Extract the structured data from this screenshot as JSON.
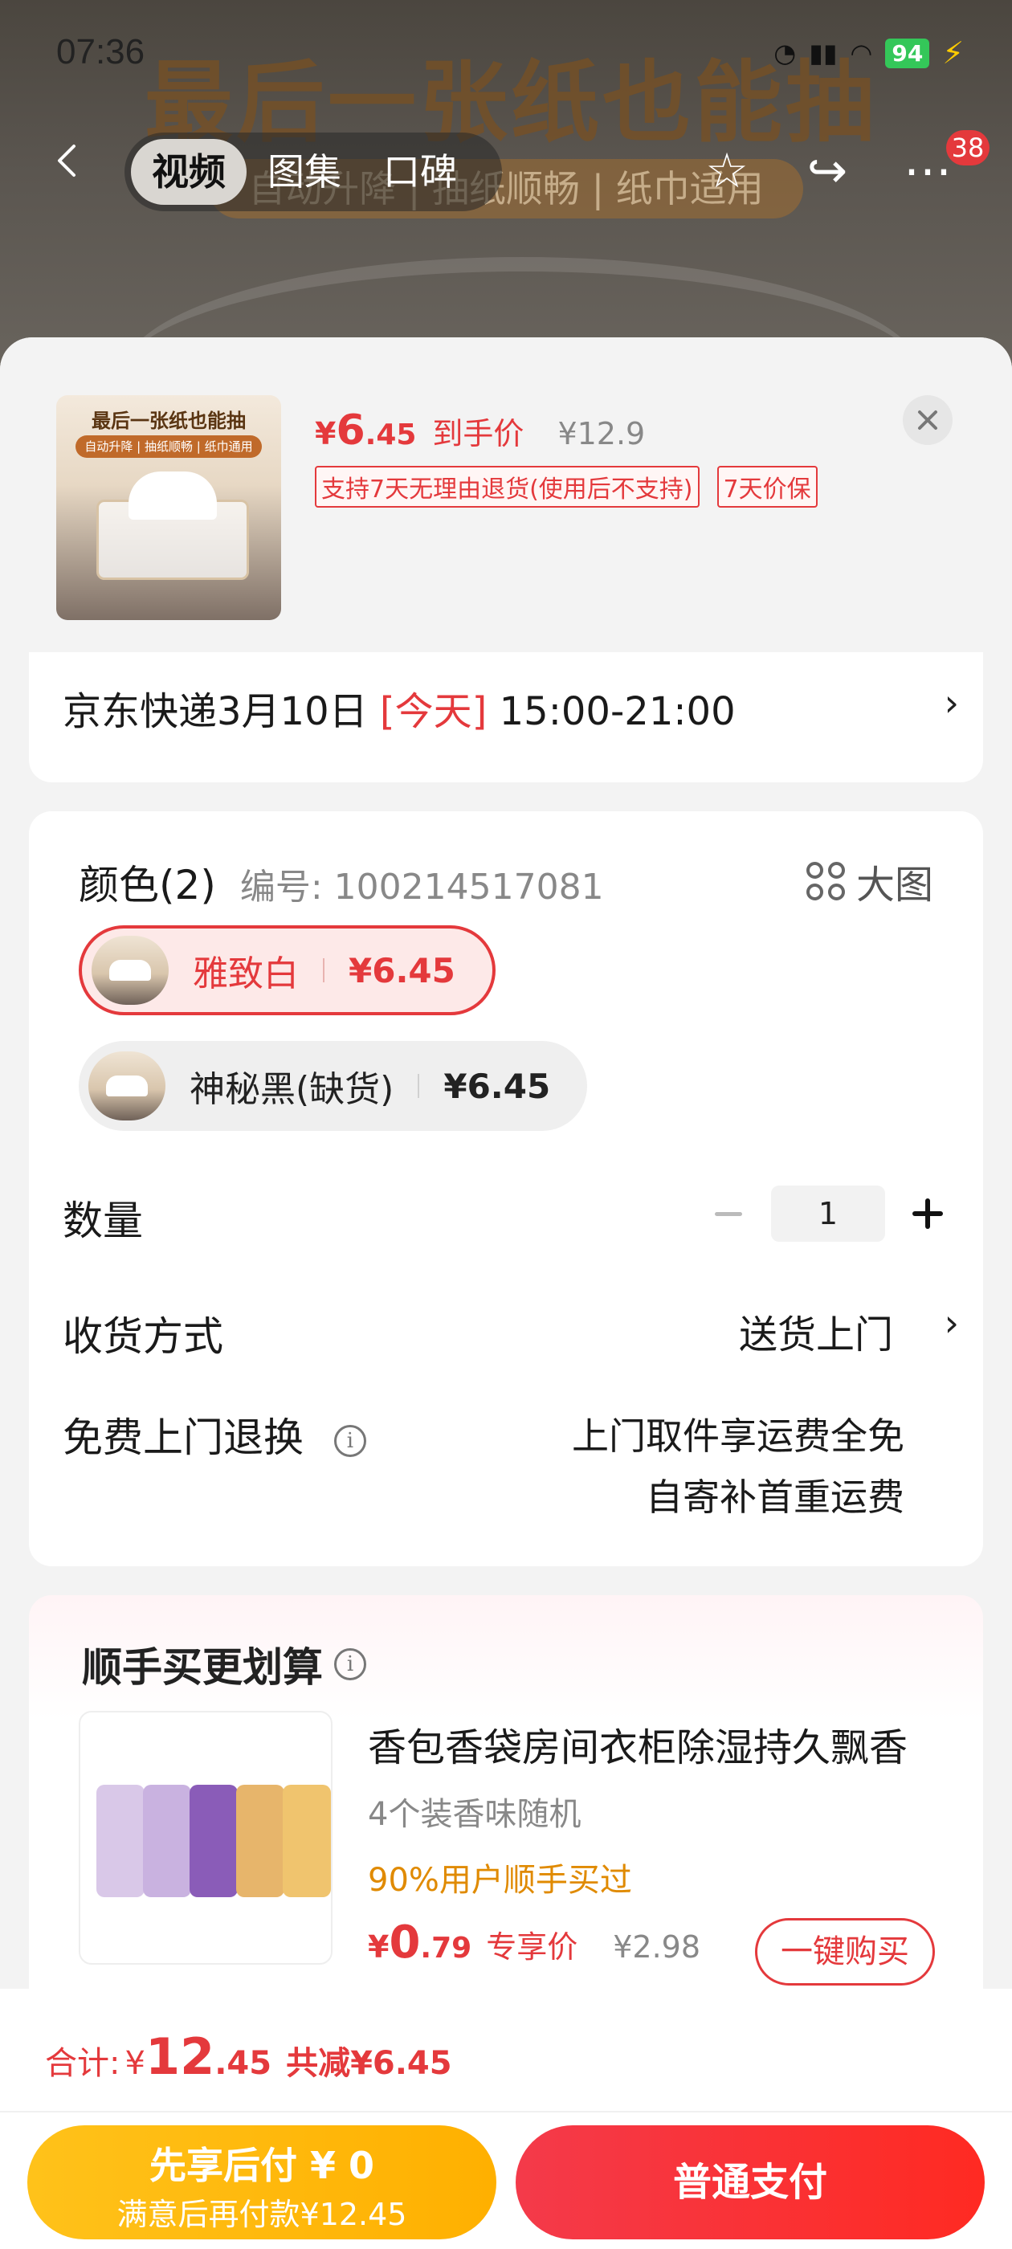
{
  "status_bar": {
    "time": "07:36",
    "battery": "94"
  },
  "hero": {
    "title": "最后一张纸也能抽",
    "subtitle": "自动升降 | 抽纸顺畅 | 纸巾适用"
  },
  "media_tabs": [
    "视频",
    "图集",
    "口碑"
  ],
  "cart_badge": "38",
  "product": {
    "thumb_title": "最后一张纸也能抽",
    "thumb_tag": "自动升降 | 抽纸顺畅 | 纸巾通用",
    "price_yen": "¥",
    "price_int": "6",
    "price_dec": ".45",
    "price_label": "到手价",
    "original_price": "¥12.9",
    "tags": [
      "支持7天无理由退货(使用后不支持)",
      "7天价保"
    ]
  },
  "shipping": {
    "prefix": "京东快递3月10日",
    "today": "[今天]",
    "window": "15:00-21:00"
  },
  "spec": {
    "title": "颜色(2)",
    "code": "编号: 100214517081",
    "big_view": "大图",
    "variants": [
      {
        "name": "雅致白",
        "suffix": "",
        "price": "¥6.45",
        "selected": true
      },
      {
        "name": "神秘黑",
        "suffix": "(缺货)",
        "price": "¥6.45",
        "selected": false
      }
    ],
    "quantity_label": "数量",
    "quantity": "1",
    "delivery_label": "收货方式",
    "delivery_value": "送货上门",
    "return_label": "免费上门退换",
    "return_lines": [
      "上门取件享运费全免",
      "自寄补首重运费"
    ]
  },
  "recommendation": {
    "title": "顺手买更划算",
    "name": "香包香袋房间衣柜除湿持久飘香",
    "spec": "4个装香味随机",
    "social": "90%用户顺手买过",
    "price_yen": "¥",
    "price_int": "0",
    "price_dec": ".79",
    "price_label": "专享价",
    "original_price": "¥2.98",
    "buy_label": "一键购买"
  },
  "footer": {
    "total_label": "合计:",
    "total_yen": "¥",
    "total_int": "12",
    "total_dec": ".45",
    "savings": "共减¥6.45",
    "later_line1": "先享后付 ¥ 0",
    "later_line2": "满意后再付款¥12.45",
    "pay_label": "普通支付"
  },
  "colors": {
    "accent": "#e4393c",
    "gold": "#ffb000"
  }
}
